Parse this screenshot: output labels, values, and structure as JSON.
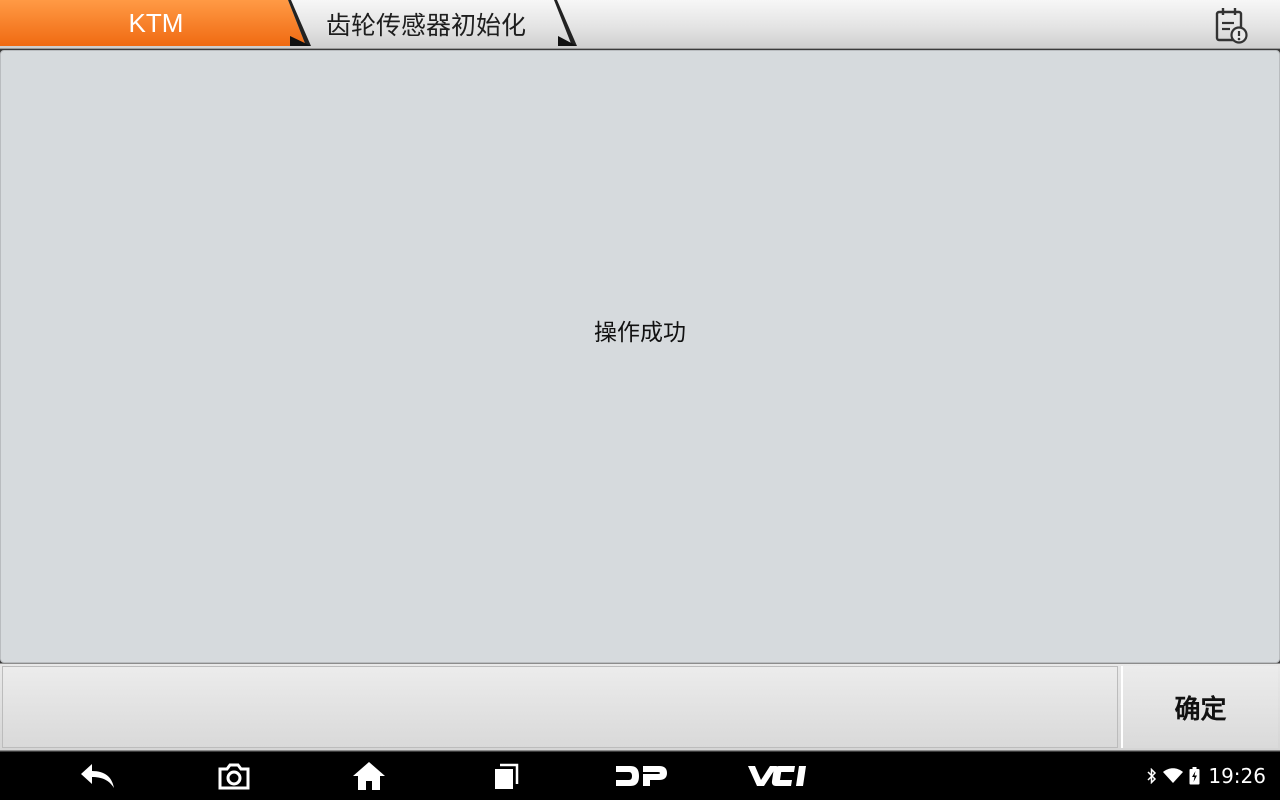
{
  "header": {
    "brand_label": "KTM",
    "page_title": "齿轮传感器初始化",
    "report_icon": "report-warning-icon"
  },
  "main": {
    "message": "操作成功"
  },
  "action_bar": {
    "confirm_label": "确定"
  },
  "nav_bar": {
    "buttons": [
      "back-icon",
      "camera-icon",
      "home-icon",
      "recents-icon",
      "dp-icon",
      "vci-icon"
    ],
    "dp_label": "DP",
    "vci_label": "VCI"
  },
  "status_bar": {
    "time": "19:26",
    "icons": [
      "bluetooth-icon",
      "wifi-icon",
      "battery-icon"
    ]
  },
  "colors": {
    "brand_orange": "#f47b20",
    "panel_bg": "#d6dadd",
    "nav_bg": "#000000"
  }
}
